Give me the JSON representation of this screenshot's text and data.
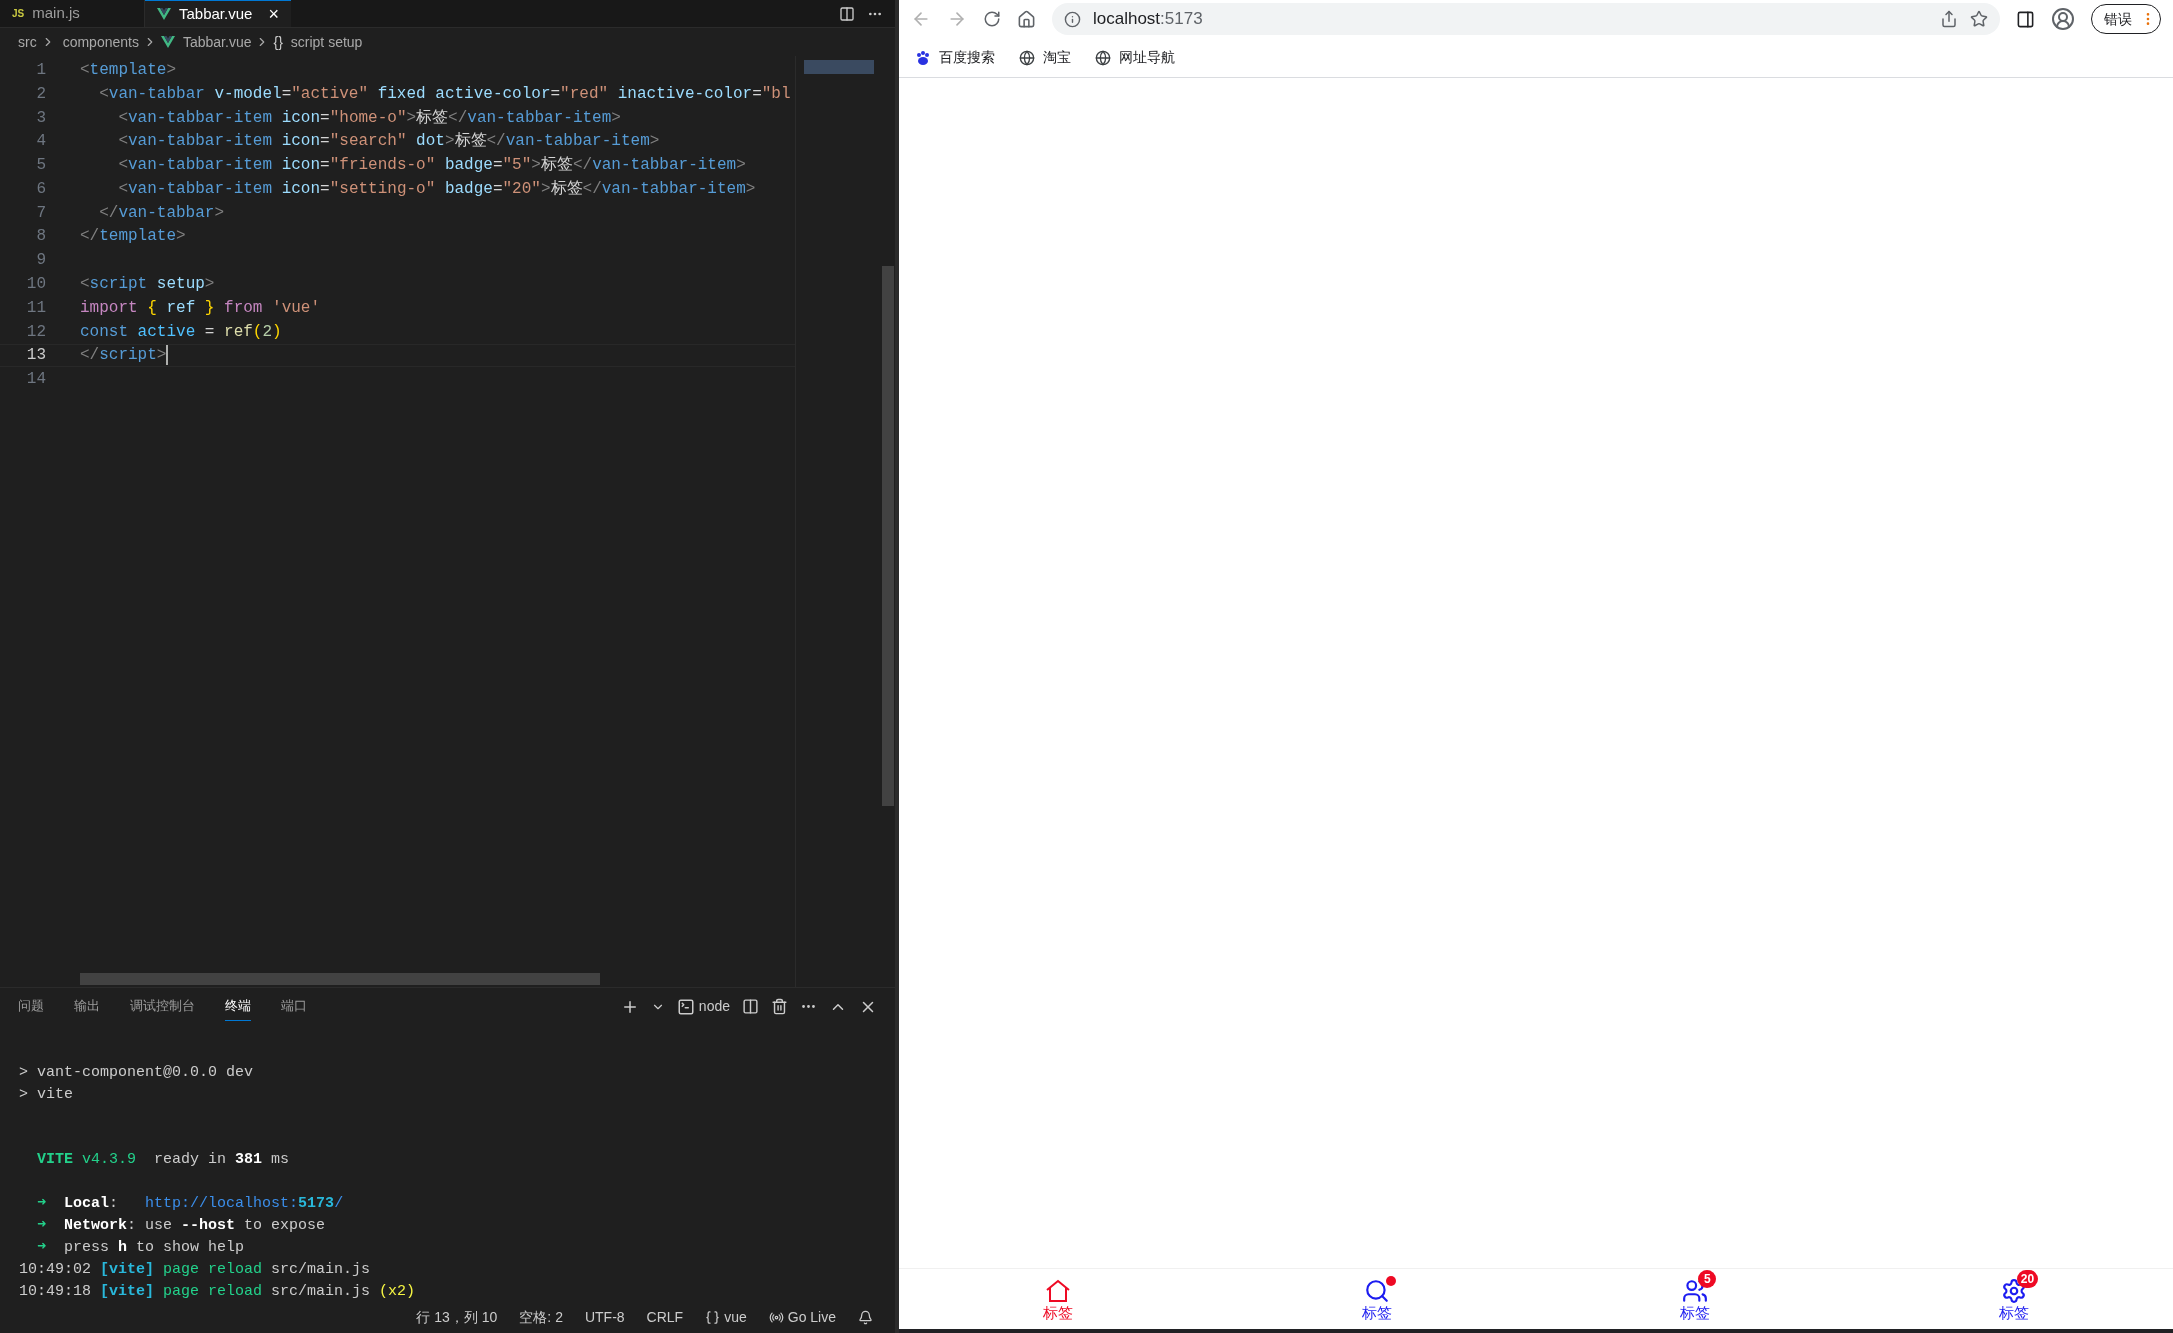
{
  "editor": {
    "tabs": [
      {
        "kind": "js",
        "icon_text": "JS",
        "label": "main.js",
        "selected": false
      },
      {
        "kind": "vue",
        "label": "Tabbar.vue",
        "selected": true,
        "close": "×"
      }
    ],
    "breadcrumb": [
      {
        "label": "src",
        "kind": "folder"
      },
      {
        "label": "components",
        "kind": "folder"
      },
      {
        "label": "Tabbar.vue",
        "kind": "vue"
      },
      {
        "label": "script setup",
        "kind": "braces",
        "glyph": "{}"
      }
    ],
    "lines": [
      {
        "number": "1",
        "current": false,
        "tokens": [
          {
            "text": "<",
            "kind": "punct"
          },
          {
            "text": "template",
            "kind": "tag"
          },
          {
            "text": ">",
            "kind": "punct"
          }
        ]
      },
      {
        "number": "2",
        "current": false,
        "tokens": [
          {
            "text": "  <",
            "kind": "punct"
          },
          {
            "text": "van-tabbar",
            "kind": "tag"
          },
          {
            "text": " v-model",
            "kind": "attr"
          },
          {
            "text": "=",
            "kind": "plain"
          },
          {
            "text": "\"active\"",
            "kind": "str"
          },
          {
            "text": " fixed active-color",
            "kind": "attr"
          },
          {
            "text": "=",
            "kind": "plain"
          },
          {
            "text": "\"red\"",
            "kind": "str"
          },
          {
            "text": " inactive-color",
            "kind": "attr"
          },
          {
            "text": "=",
            "kind": "plain"
          },
          {
            "text": "\"bl",
            "kind": "str"
          }
        ]
      },
      {
        "number": "3",
        "current": false,
        "tokens": [
          {
            "text": "    <",
            "kind": "punct"
          },
          {
            "text": "van-tabbar-item",
            "kind": "tag"
          },
          {
            "text": " icon",
            "kind": "attr"
          },
          {
            "text": "=",
            "kind": "plain"
          },
          {
            "text": "\"home-o\"",
            "kind": "str"
          },
          {
            "text": ">",
            "kind": "punct"
          },
          {
            "text": "标签",
            "kind": "plain"
          },
          {
            "text": "</",
            "kind": "punct"
          },
          {
            "text": "van-tabbar-item",
            "kind": "tag"
          },
          {
            "text": ">",
            "kind": "punct"
          }
        ]
      },
      {
        "number": "4",
        "current": false,
        "tokens": [
          {
            "text": "    <",
            "kind": "punct"
          },
          {
            "text": "van-tabbar-item",
            "kind": "tag"
          },
          {
            "text": " icon",
            "kind": "attr"
          },
          {
            "text": "=",
            "kind": "plain"
          },
          {
            "text": "\"search\"",
            "kind": "str"
          },
          {
            "text": " dot",
            "kind": "attr"
          },
          {
            "text": ">",
            "kind": "punct"
          },
          {
            "text": "标签",
            "kind": "plain"
          },
          {
            "text": "</",
            "kind": "punct"
          },
          {
            "text": "van-tabbar-item",
            "kind": "tag"
          },
          {
            "text": ">",
            "kind": "punct"
          }
        ]
      },
      {
        "number": "5",
        "current": false,
        "tokens": [
          {
            "text": "    <",
            "kind": "punct"
          },
          {
            "text": "van-tabbar-item",
            "kind": "tag"
          },
          {
            "text": " icon",
            "kind": "attr"
          },
          {
            "text": "=",
            "kind": "plain"
          },
          {
            "text": "\"friends-o\"",
            "kind": "str"
          },
          {
            "text": " badge",
            "kind": "attr"
          },
          {
            "text": "=",
            "kind": "plain"
          },
          {
            "text": "\"5\"",
            "kind": "str"
          },
          {
            "text": ">",
            "kind": "punct"
          },
          {
            "text": "标签",
            "kind": "plain"
          },
          {
            "text": "</",
            "kind": "punct"
          },
          {
            "text": "van-tabbar-item",
            "kind": "tag"
          },
          {
            "text": ">",
            "kind": "punct"
          }
        ]
      },
      {
        "number": "6",
        "current": false,
        "tokens": [
          {
            "text": "    <",
            "kind": "punct"
          },
          {
            "text": "van-tabbar-item",
            "kind": "tag"
          },
          {
            "text": " icon",
            "kind": "attr"
          },
          {
            "text": "=",
            "kind": "plain"
          },
          {
            "text": "\"setting-o\"",
            "kind": "str"
          },
          {
            "text": " badge",
            "kind": "attr"
          },
          {
            "text": "=",
            "kind": "plain"
          },
          {
            "text": "\"20\"",
            "kind": "str"
          },
          {
            "text": ">",
            "kind": "punct"
          },
          {
            "text": "标签",
            "kind": "plain"
          },
          {
            "text": "</",
            "kind": "punct"
          },
          {
            "text": "van-tabbar-item",
            "kind": "tag"
          },
          {
            "text": ">",
            "kind": "punct"
          }
        ]
      },
      {
        "number": "7",
        "current": false,
        "tokens": [
          {
            "text": "  </",
            "kind": "punct"
          },
          {
            "text": "van-tabbar",
            "kind": "tag"
          },
          {
            "text": ">",
            "kind": "punct"
          }
        ]
      },
      {
        "number": "8",
        "current": false,
        "tokens": [
          {
            "text": "</",
            "kind": "punct"
          },
          {
            "text": "template",
            "kind": "tag"
          },
          {
            "text": ">",
            "kind": "punct"
          }
        ]
      },
      {
        "number": "9",
        "current": false
      },
      {
        "number": "10",
        "current": false,
        "tokens": [
          {
            "text": "<",
            "kind": "punct"
          },
          {
            "text": "script",
            "kind": "tag"
          },
          {
            "text": " setup",
            "kind": "attr"
          },
          {
            "text": ">",
            "kind": "punct"
          }
        ]
      },
      {
        "number": "11",
        "current": false,
        "tokens": [
          {
            "text": "import ",
            "kind": "keyword"
          },
          {
            "text": "{",
            "kind": "brace"
          },
          {
            "text": " ref ",
            "kind": "var"
          },
          {
            "text": "}",
            "kind": "brace"
          },
          {
            "text": " from ",
            "kind": "keyword"
          },
          {
            "text": "'vue'",
            "kind": "str"
          }
        ]
      },
      {
        "number": "12",
        "current": false,
        "tokens": [
          {
            "text": "const",
            "kind": "storage"
          },
          {
            "text": " active",
            "kind": "const"
          },
          {
            "text": " = ",
            "kind": "plain"
          },
          {
            "text": "ref",
            "kind": "fn"
          },
          {
            "text": "(",
            "kind": "brace"
          },
          {
            "text": "2",
            "kind": "num"
          },
          {
            "text": ")",
            "kind": "brace"
          }
        ]
      },
      {
        "number": "13",
        "current": true,
        "tokens": [
          {
            "text": "</",
            "kind": "punct"
          },
          {
            "text": "script",
            "kind": "tag"
          },
          {
            "text": ">",
            "kind": "punct"
          }
        ]
      },
      {
        "number": "14",
        "current": false
      }
    ]
  },
  "panel": {
    "tabs": [
      {
        "label": "问题",
        "selected": false
      },
      {
        "label": "输出",
        "selected": false
      },
      {
        "label": "调试控制台",
        "selected": false
      },
      {
        "label": "终端",
        "selected": true
      },
      {
        "label": "端口",
        "selected": false
      }
    ],
    "terminal_name": "node",
    "blocks": [
      [
        [
          {
            "text": "> vant-component@0.0.0 dev",
            "kind": "plain"
          }
        ],
        [
          {
            "text": "> vite",
            "kind": "plain"
          }
        ]
      ],
      [
        [
          {
            "text": "  VITE",
            "kind": "greenb"
          },
          {
            "text": " v4.3.9",
            "kind": "green"
          },
          {
            "text": "  ready in ",
            "kind": "plain"
          },
          {
            "text": "381",
            "kind": "bold"
          },
          {
            "text": " ms",
            "kind": "plain"
          }
        ]
      ],
      [
        [
          {
            "text": "  ➜",
            "kind": "green"
          },
          {
            "text": "  Local",
            "kind": "bold"
          },
          {
            "text": ":   ",
            "kind": "plain"
          },
          {
            "text": "http://localhost:",
            "kind": "link"
          },
          {
            "text": "5173",
            "kind": "linkb"
          },
          {
            "text": "/",
            "kind": "link"
          }
        ],
        [
          {
            "text": "  ➜",
            "kind": "green"
          },
          {
            "text": "  Network",
            "kind": "bold"
          },
          {
            "text": ": use ",
            "kind": "plain"
          },
          {
            "text": "--host",
            "kind": "bold"
          },
          {
            "text": " to expose",
            "kind": "plain"
          }
        ],
        [
          {
            "text": "  ➜",
            "kind": "green"
          },
          {
            "text": "  press ",
            "kind": "plain"
          },
          {
            "text": "h",
            "kind": "bold"
          },
          {
            "text": " to show help",
            "kind": "plain"
          }
        ],
        [
          {
            "text": "10:49:02 ",
            "kind": "plain"
          },
          {
            "text": "[vite]",
            "kind": "cyanb"
          },
          {
            "text": " page reload",
            "kind": "green"
          },
          {
            "text": " src/main.js",
            "kind": "plain"
          }
        ],
        [
          {
            "text": "10:49:18 ",
            "kind": "plain"
          },
          {
            "text": "[vite]",
            "kind": "cyanb"
          },
          {
            "text": " page reload",
            "kind": "green"
          },
          {
            "text": " src/main.js ",
            "kind": "plain"
          },
          {
            "text": "(x2)",
            "kind": "yellow"
          }
        ]
      ]
    ]
  },
  "status_bar": [
    {
      "kind": "text",
      "label": "行 13，列 10"
    },
    {
      "kind": "text",
      "label": "空格: 2"
    },
    {
      "kind": "text",
      "label": "UTF-8"
    },
    {
      "kind": "text",
      "label": "CRLF"
    },
    {
      "kind": "language",
      "label": "vue"
    },
    {
      "kind": "live",
      "label": "Go Live"
    },
    {
      "kind": "bell"
    }
  ],
  "browser": {
    "url_host": "localhost",
    "url_port": ":5173",
    "profile_button": "错误",
    "bookmarks": [
      {
        "label": "百度搜索",
        "kind": "baidu"
      },
      {
        "label": "淘宝",
        "kind": "globe"
      },
      {
        "label": "网址导航",
        "kind": "globe"
      }
    ],
    "tabbar": [
      {
        "label": "标签",
        "kind": "home",
        "selected": true
      },
      {
        "label": "标签",
        "kind": "search",
        "selected": false,
        "dot": true
      },
      {
        "label": "标签",
        "kind": "friends",
        "selected": false,
        "badge": "5"
      },
      {
        "label": "标签",
        "kind": "settings",
        "selected": false,
        "badge": "20"
      }
    ]
  }
}
